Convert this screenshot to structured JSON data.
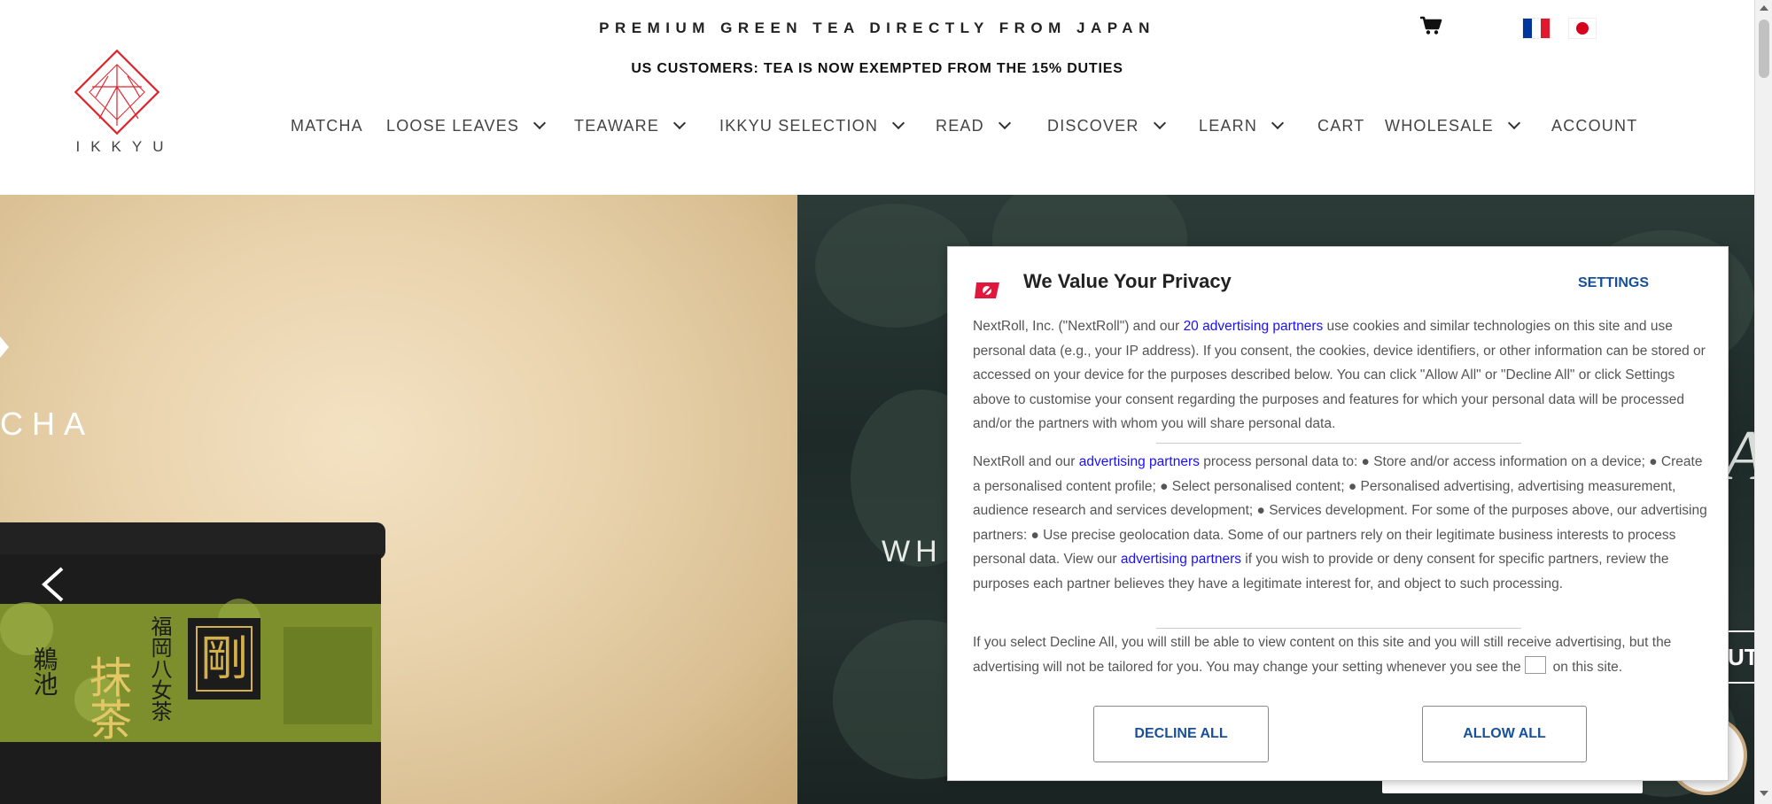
{
  "header": {
    "tagline": "PREMIUM GREEN TEA DIRECTLY FROM JAPAN",
    "notice": "US CUSTOMERS: TEA IS NOW EXEMPTED FROM THE 15% DUTIES",
    "logo_text": "IKKYU",
    "cart_icon": "cart-icon",
    "flags": [
      "fr-flag",
      "jp-flag"
    ]
  },
  "nav": {
    "items": [
      {
        "label": "MATCHA",
        "has_dropdown": false
      },
      {
        "label": "LOOSE LEAVES",
        "has_dropdown": true
      },
      {
        "label": "TEAWARE",
        "has_dropdown": true
      },
      {
        "label": "IKKYU SELECTION",
        "has_dropdown": true
      },
      {
        "label": "READ",
        "has_dropdown": true
      },
      {
        "label": "DISCOVER",
        "has_dropdown": true
      },
      {
        "label": "LEARN",
        "has_dropdown": true
      },
      {
        "label": "CART",
        "has_dropdown": false
      },
      {
        "label": "WHOLESALE",
        "has_dropdown": true
      },
      {
        "label": "ACCOUNT",
        "has_dropdown": false
      }
    ]
  },
  "hero": {
    "left_caption": "CHA",
    "right_caption": "WH",
    "right_big_letter": "A",
    "right_button_partial": "UT",
    "tin_label_1": "抹茶",
    "tin_label_2": "剛",
    "tin_label_3": "鵜池",
    "tin_label_4": "福岡八女茶"
  },
  "privacy": {
    "title": "We Value Your Privacy",
    "settings": "SETTINGS",
    "p1_a": "NextRoll, Inc. (\"NextRoll\") and our ",
    "p1_link": "20 advertising partners",
    "p1_b": " use cookies and similar technologies on this site and use personal data (e.g., your IP address). If you consent, the cookies, device identifiers, or other information can be stored or accessed on your device for the purposes described below. You can click \"Allow All\" or \"Decline All\" or click Settings above to customise your consent regarding the purposes and features for which your personal data will be processed and/or the partners with whom you will share personal data.",
    "p2_a": "NextRoll and our ",
    "p2_link1": "advertising partners",
    "p2_b": " process personal data to: ● Store and/or access information on a device; ● Create a personalised content profile; ● Select personalised content; ● Personalised advertising, advertising measurement, audience research and services development; ● Services development. For some of the purposes above, our advertising partners: ● Use precise geolocation data. Some of our partners rely on their legitimate business interests to process personal data. View our ",
    "p2_link2": "advertising partners",
    "p2_c": " if you wish to provide or deny consent for specific partners, review the purposes each partner believes they have a legitimate interest for, and object to such processing.",
    "p3_a": "If you select Decline All, you will still be able to view content on this site and you will still receive advertising, but the advertising will not be tailored for you. You may change your setting whenever you see the",
    "p3_b": "on this site.",
    "decline": "DECLINE ALL",
    "allow": "ALLOW ALL"
  },
  "colors": {
    "logo_red": "#e0242e",
    "link_blue": "#1a10ff",
    "button_blue": "#17509a",
    "nextroll_red": "#e2173d"
  }
}
